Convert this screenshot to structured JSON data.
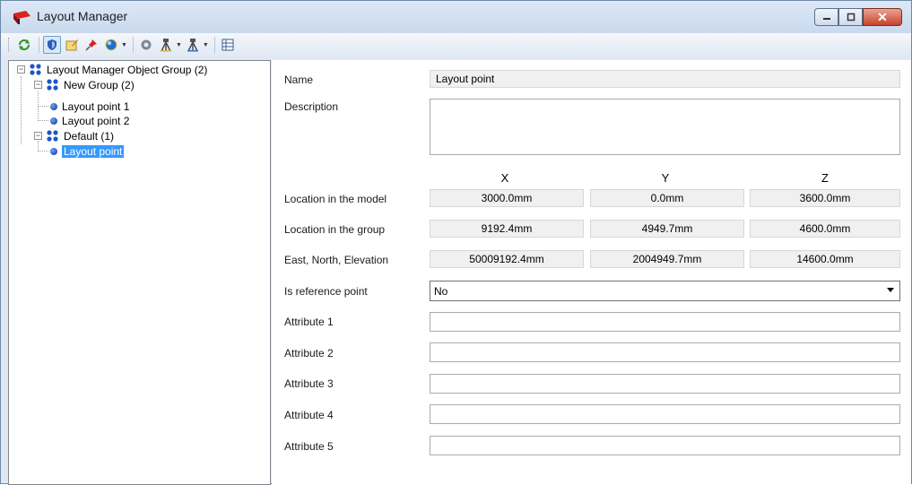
{
  "window": {
    "title": "Layout Manager",
    "icon": "layout-manager-app-icon",
    "controls": [
      "minimize",
      "restore",
      "close"
    ]
  },
  "toolbar": {
    "icons": [
      "refresh-icon",
      "shield-icon",
      "edit-note-icon",
      "pin-icon",
      "sphere-dropdown-icon",
      "gear-icon",
      "tripod-icon",
      "tripod-alt-icon",
      "table-icon"
    ]
  },
  "tree": {
    "root_label": "Layout Manager Object Group (2)",
    "groups": [
      {
        "label": "New Group (2)",
        "items": [
          "Layout point 1",
          "Layout point 2"
        ]
      },
      {
        "label": "Default (1)",
        "items": [
          "Layout point"
        ]
      }
    ],
    "selected": "Layout point"
  },
  "form": {
    "name_label": "Name",
    "name_value": "Layout point",
    "description_label": "Description",
    "description_value": "",
    "columns": [
      "X",
      "Y",
      "Z"
    ],
    "rows": [
      {
        "label": "Location in the model",
        "values": [
          "3000.0mm",
          "0.0mm",
          "3600.0mm"
        ]
      },
      {
        "label": "Location in the group",
        "values": [
          "9192.4mm",
          "4949.7mm",
          "4600.0mm"
        ]
      },
      {
        "label": "East, North, Elevation",
        "values": [
          "50009192.4mm",
          "2004949.7mm",
          "14600.0mm"
        ]
      }
    ],
    "reference_label": "Is reference point",
    "reference_value": "No",
    "attributes": [
      {
        "label": "Attribute 1",
        "value": ""
      },
      {
        "label": "Attribute 2",
        "value": ""
      },
      {
        "label": "Attribute 3",
        "value": ""
      },
      {
        "label": "Attribute 4",
        "value": ""
      },
      {
        "label": "Attribute 5",
        "value": ""
      }
    ]
  },
  "colors": {
    "selection": "#3399ff",
    "close_button": "#c7432b",
    "readonly_field": "#f0f0f0"
  }
}
